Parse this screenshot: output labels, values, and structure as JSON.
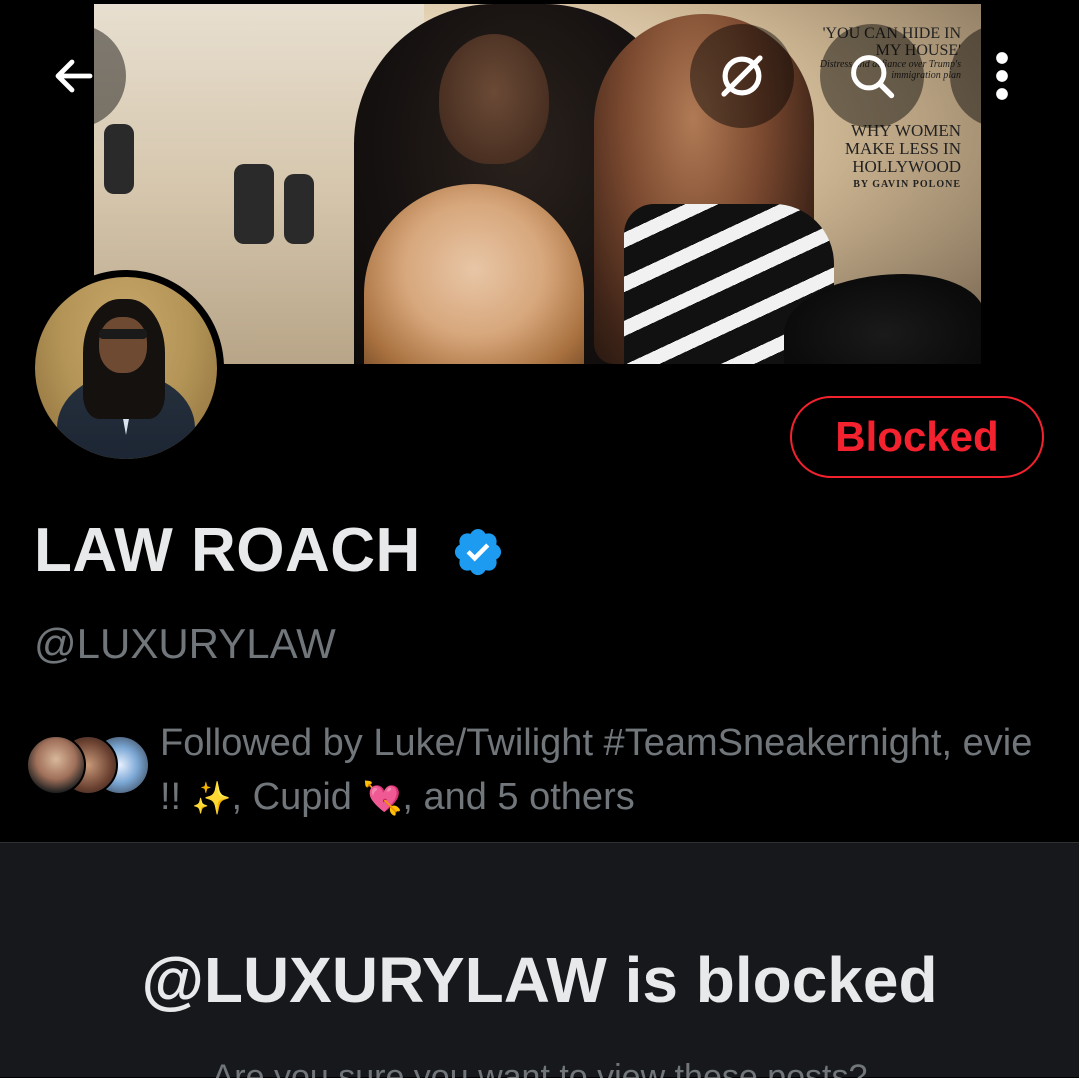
{
  "banner": {
    "cover_lines": {
      "headline1": "'YOU CAN HIDE IN MY HOUSE'",
      "sub1": "Distress and defiance over Trump's immigration plan",
      "headline2": "WHY WOMEN MAKE LESS IN HOLLYWOOD",
      "byline": "BY GAVIN POLONE"
    }
  },
  "header": {
    "back_icon": "arrow-left-icon",
    "grok_icon": "grok-icon",
    "search_icon": "search-icon",
    "more_icon": "more-vertical-icon"
  },
  "profile": {
    "display_name": "LAW ROACH",
    "handle": "@LUXURYLAW",
    "verified": true,
    "relationship_button": "Blocked",
    "followed_by": {
      "prefix": "Followed by ",
      "name1": "Luke/Twilight #TeamSneakernight",
      "sep1": ", ",
      "name2": "evie !! ",
      "emoji2": "✨",
      "sep2": ", ",
      "name3": "Cupid ",
      "emoji3": "💘",
      "suffix": ", and 5 others"
    }
  },
  "blocked_notice": {
    "title": "@LUXURYLAW is blocked",
    "subtitle": "Are you sure you want to view these posts?"
  },
  "colors": {
    "background": "#000000",
    "accent_red": "#f4212e",
    "verified_blue": "#1d9bf0",
    "muted_text": "#71767b",
    "panel": "#16181c"
  }
}
